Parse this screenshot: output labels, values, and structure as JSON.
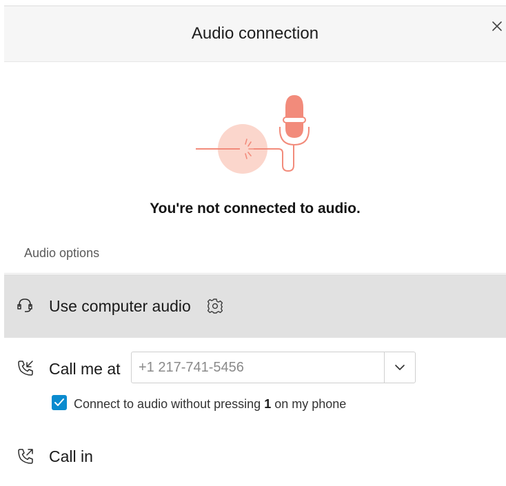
{
  "header": {
    "title": "Audio connection",
    "close_icon": "close-icon"
  },
  "status": {
    "message": "You're not connected to audio.",
    "illustration_icon": "microphone-disconnected-icon",
    "accent_color": "#f28b7b"
  },
  "options": {
    "section_label": "Audio options",
    "computer_audio": {
      "label": "Use computer audio",
      "icon": "headset-icon",
      "settings_icon": "gear-icon"
    },
    "call_me": {
      "label": "Call me at",
      "icon": "phone-callback-icon",
      "phone_value": "+1 217-741-5456",
      "dropdown_icon": "chevron-down-icon",
      "checkbox_checked": true,
      "checkbox_label_prefix": "Connect to audio without pressing",
      "checkbox_label_key": "1",
      "checkbox_label_suffix": "on my phone",
      "checkbox_color": "#0a8bcf"
    },
    "call_in": {
      "label": "Call in",
      "icon": "phone-outgoing-icon"
    }
  }
}
